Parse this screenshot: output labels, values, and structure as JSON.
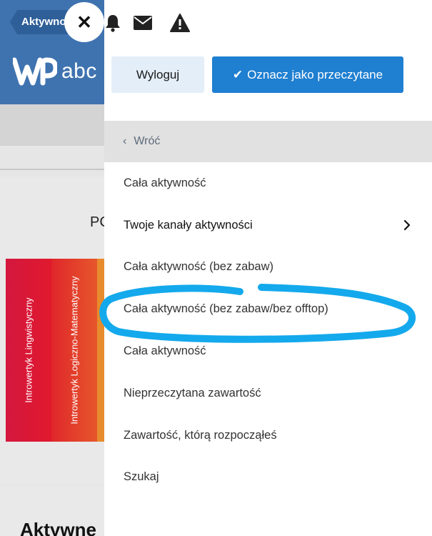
{
  "background": {
    "breadcrumb": "Aktywno",
    "logo_text": "abc",
    "card_title_fragment": "PC",
    "strips": [
      "Introwertyk Lingwistyczny",
      "Introwertyk Logiczno-Matematyczny"
    ],
    "bottom_title": "Aktywne"
  },
  "close_glyph": "✕",
  "toolbar": {
    "icons": [
      "bell-icon",
      "envelope-icon",
      "warning-icon"
    ]
  },
  "buttons": {
    "logout_label": "Wyloguj",
    "mark_read_label": "Oznacz jako przeczytane",
    "mark_read_icon": "✔"
  },
  "back": {
    "chevron": "‹",
    "label": "Wróć"
  },
  "menu": {
    "items": [
      {
        "label": "Cała aktywność",
        "submenu": false
      },
      {
        "label": "Twoje kanały aktywności",
        "submenu": true
      },
      {
        "label": "Cała aktywność (bez zabaw)",
        "submenu": false
      },
      {
        "label": "Cała aktywność (bez zabaw/bez offtop)",
        "submenu": false
      },
      {
        "label": "Cała aktywność",
        "submenu": false
      },
      {
        "label": "Nieprzeczytana zawartość",
        "submenu": false
      },
      {
        "label": "Zawartość, którą rozpocząłeś",
        "submenu": false
      },
      {
        "label": "Szukaj",
        "submenu": false
      }
    ]
  },
  "colors": {
    "header_blue": "#3f73b0",
    "primary_button": "#1f7fd1",
    "secondary_button": "#e3eef9",
    "highlight_stroke": "#14a9ec"
  }
}
